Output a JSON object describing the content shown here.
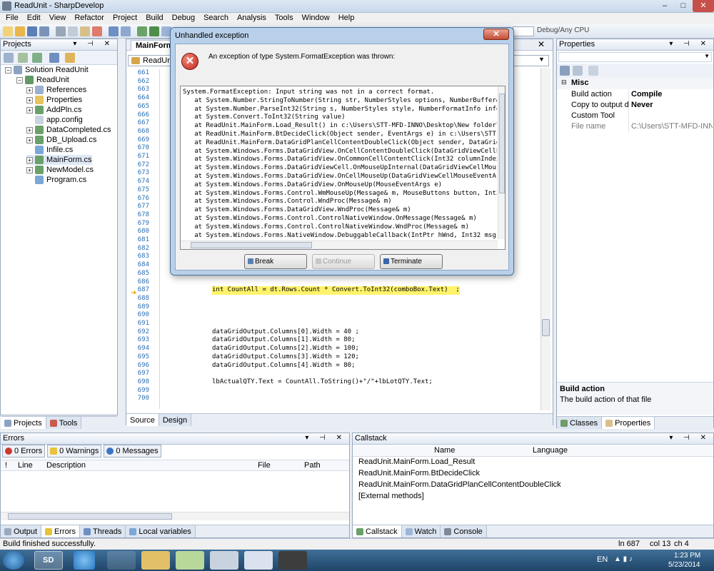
{
  "window": {
    "title": "ReadUnit - SharpDevelop",
    "controls": [
      "–",
      "□",
      "✕"
    ]
  },
  "menu": [
    "File",
    "Edit",
    "View",
    "Refactor",
    "Project",
    "Build",
    "Debug",
    "Search",
    "Analysis",
    "Tools",
    "Window",
    "Help"
  ],
  "toolbar": {
    "debug_config_label": "Debug/Any CPU"
  },
  "projects_panel": {
    "title": "Projects",
    "tree": [
      {
        "label": "Solution ReadUnit",
        "level": 0
      },
      {
        "label": "ReadUnit",
        "level": 1
      },
      {
        "label": "References",
        "level": 2
      },
      {
        "label": "Properties",
        "level": 2
      },
      {
        "label": "AddPln.cs",
        "level": 2
      },
      {
        "label": "app.config",
        "level": 2
      },
      {
        "label": "DataCompleted.cs",
        "level": 2
      },
      {
        "label": "DB_Upload.cs",
        "level": 2
      },
      {
        "label": "Infile.cs",
        "level": 2
      },
      {
        "label": "MainForm.cs",
        "level": 2
      },
      {
        "label": "NewModel.cs",
        "level": 2
      },
      {
        "label": "Program.cs",
        "level": 2
      }
    ],
    "tabs": [
      "Projects",
      "Tools"
    ]
  },
  "editor": {
    "tab": "MainForm.cs",
    "class_dropdown": "ReadUnit.MainForm",
    "tabs": [
      "Source",
      "Design"
    ],
    "lines": [
      {
        "n": "661",
        "t": ""
      },
      {
        "n": "662",
        "t": ""
      },
      {
        "n": "663",
        "t": ""
      },
      {
        "n": "664",
        "t": ""
      },
      {
        "n": "665",
        "t": ""
      },
      {
        "n": "666",
        "t": ""
      },
      {
        "n": "667",
        "t": ""
      },
      {
        "n": "668",
        "t": ""
      },
      {
        "n": "669",
        "t": ""
      },
      {
        "n": "670",
        "t": ""
      },
      {
        "n": "671",
        "t": ""
      },
      {
        "n": "672",
        "t": ""
      },
      {
        "n": "673",
        "t": ""
      },
      {
        "n": "674",
        "t": ""
      },
      {
        "n": "675",
        "t": ""
      },
      {
        "n": "676",
        "t": ""
      },
      {
        "n": "677",
        "t": ""
      },
      {
        "n": "678",
        "t": ""
      },
      {
        "n": "679",
        "t": ""
      },
      {
        "n": "680",
        "t": ""
      },
      {
        "n": "681",
        "t": ""
      },
      {
        "n": "682",
        "t": ""
      },
      {
        "n": "683",
        "t": ""
      },
      {
        "n": "684",
        "t": ""
      },
      {
        "n": "685",
        "t": ""
      },
      {
        "n": "686",
        "t": ""
      },
      {
        "n": "687",
        "t": "int CountAll = dt.Rows.Count * Convert.ToInt32(comboBox.Text)  ;"
      },
      {
        "n": "688",
        "t": ""
      },
      {
        "n": "689",
        "t": ""
      },
      {
        "n": "690",
        "t": ""
      },
      {
        "n": "691",
        "t": ""
      },
      {
        "n": "692",
        "t": "dataGridOutput.Columns[0].Width = 40 ;"
      },
      {
        "n": "693",
        "t": "dataGridOutput.Columns[1].Width = 80;"
      },
      {
        "n": "694",
        "t": "dataGridOutput.Columns[2].Width = 100;"
      },
      {
        "n": "695",
        "t": "dataGridOutput.Columns[3].Width = 120;"
      },
      {
        "n": "696",
        "t": "dataGridOutput.Columns[4].Width = 80;"
      },
      {
        "n": "697",
        "t": ""
      },
      {
        "n": "698",
        "t": "lbActualQTY.Text = CountAll.ToString()+\"/\"+lbLotQTY.Text;"
      },
      {
        "n": "699",
        "t": ""
      },
      {
        "n": "700",
        "t": ""
      }
    ]
  },
  "dialog": {
    "title": "Unhandled exception",
    "close": "✕",
    "message": "An exception of type System.FormatException was thrown:",
    "stack": [
      "System.FormatException: Input string was not in a correct format.",
      "   at System.Number.StringToNumber(String str, NumberStyles options, NumberBuffer&",
      "   at System.Number.ParseInt32(String s, NumberStyles style, NumberFormatInfo info",
      "   at System.Convert.ToInt32(String value)",
      "   at ReadUnit.MainForm.Load_Result() in c:\\Users\\STT-MFD-INNO\\Desktop\\New folder\\",
      "   at ReadUnit.MainForm.BtDecideClick(Object sender, EventArgs e) in c:\\Users\\STT-",
      "   at ReadUnit.MainForm.DataGridPlanCellContentDoubleClick(Object sender, DataGrid",
      "   at System.Windows.Forms.DataGridView.OnCellContentDoubleClick(DataGridViewCellE",
      "   at System.Windows.Forms.DataGridView.OnCommonCellContentClick(Int32 columnIndex",
      "   at System.Windows.Forms.DataGridViewCell.OnMouseUpInternal(DataGridViewCellMous",
      "   at System.Windows.Forms.DataGridView.OnCellMouseUp(DataGridViewCellMouseEventAr",
      "   at System.Windows.Forms.DataGridView.OnMouseUp(MouseEventArgs e)",
      "   at System.Windows.Forms.Control.WmMouseUp(Message& m, MouseButtons button, Int3",
      "   at System.Windows.Forms.Control.WndProc(Message& m)",
      "   at System.Windows.Forms.DataGridView.WndProc(Message& m)",
      "   at System.Windows.Forms.Control.ControlNativeWindow.OnMessage(Message& m)",
      "   at System.Windows.Forms.Control.ControlNativeWindow.WndProc(Message& m)",
      "   at System.Windows.Forms.NativeWindow.DebuggableCallback(IntPtr hWnd, Int32 msg,"
    ],
    "buttons": {
      "break": "Break",
      "continue": "Continue",
      "terminate": "Terminate"
    }
  },
  "properties_panel": {
    "title": "Properties",
    "category": "Misc",
    "rows": [
      {
        "name": "Build action",
        "value": "Compile",
        "bold": true
      },
      {
        "name": "Copy to output dire",
        "value": "Never",
        "bold": true
      },
      {
        "name": "Custom Tool",
        "value": "",
        "bold": false
      },
      {
        "name": "File name",
        "value": "C:\\Users\\STT-MFD-INNO\\D",
        "bold": false
      }
    ],
    "desc_title": "Build action",
    "desc_text": "The build action of that file",
    "tabs": [
      "Classes",
      "Properties"
    ]
  },
  "errors_panel": {
    "title": "Errors",
    "filters": [
      "0 Errors",
      "0 Warnings",
      "0 Messages"
    ],
    "columns": [
      "!",
      "Line",
      "Description",
      "File",
      "Path"
    ],
    "tabs": [
      "Output",
      "Errors",
      "Threads",
      "Local variables"
    ]
  },
  "callstack_panel": {
    "title": "Callstack",
    "columns": [
      "Name",
      "Language"
    ],
    "rows": [
      "ReadUnit.MainForm.Load_Result",
      "ReadUnit.MainForm.BtDecideClick",
      "ReadUnit.MainForm.DataGridPlanCellContentDoubleClick",
      "[External methods]"
    ],
    "tabs": [
      "Callstack",
      "Watch",
      "Console"
    ]
  },
  "statusbar": {
    "message": "Build finished successfully.",
    "line": "ln 687",
    "col": "col 13",
    "ch": "ch 4"
  },
  "taskbar": {
    "lang": "EN",
    "time": "1:23 PM",
    "date": "5/23/2014",
    "sd_label": "SD"
  }
}
